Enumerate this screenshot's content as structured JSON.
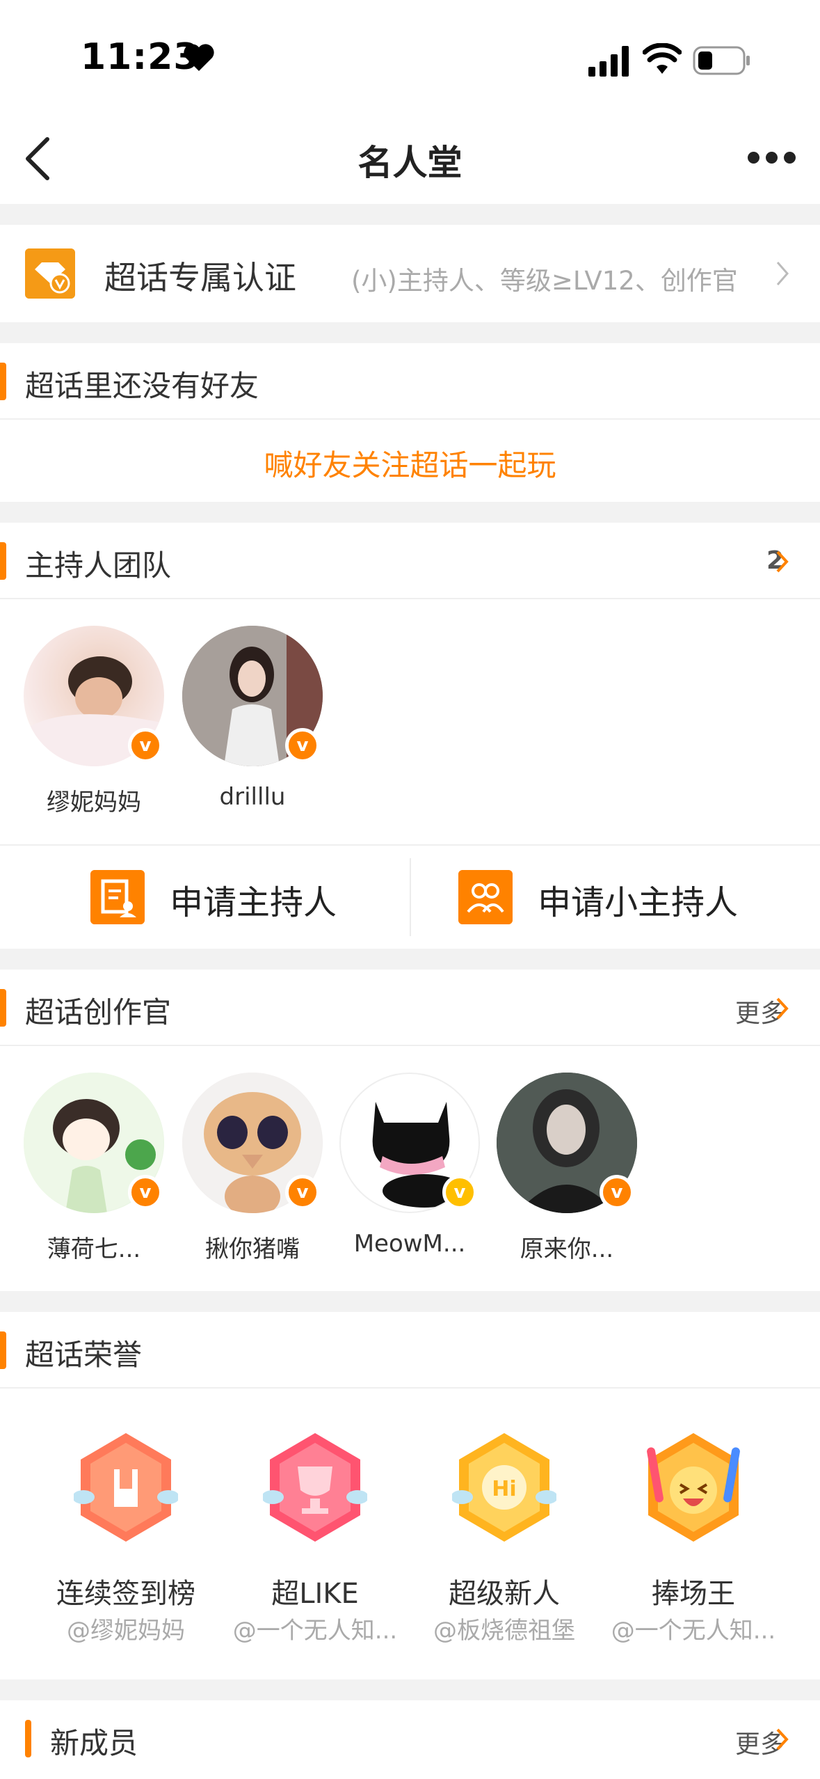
{
  "status_bar": {
    "time": "11:23"
  },
  "nav": {
    "title": "名人堂"
  },
  "cert": {
    "label": "超话专属认证",
    "requirements": "(小)主持人、等级≥LV12、创作官"
  },
  "friends": {
    "title": "超话里还没有好友",
    "invite": "喊好友关注超话一起玩"
  },
  "hosts": {
    "title": "主持人团队",
    "count": "2",
    "members": [
      {
        "name": "缪妮妈妈"
      },
      {
        "name": "drilllu"
      }
    ]
  },
  "apply": {
    "host": "申请主持人",
    "junior_host": "申请小主持人"
  },
  "creators": {
    "title": "超话创作官",
    "more": "更多",
    "members": [
      {
        "name": "薄荷七..."
      },
      {
        "name": "揪你猪嘴"
      },
      {
        "name": "MeowM..."
      },
      {
        "name": "原来你..."
      }
    ]
  },
  "honors": {
    "title": "超话荣誉",
    "items": [
      {
        "title": "连续签到榜",
        "holder": "@缪妮妈妈"
      },
      {
        "title": "超LIKE",
        "holder": "@一个无人知..."
      },
      {
        "title": "超级新人",
        "holder": "@板烧德祖堡"
      },
      {
        "title": "捧场王",
        "holder": "@一个无人知..."
      }
    ]
  },
  "new_members": {
    "title": "新成员",
    "more": "更多"
  },
  "colors": {
    "accent": "#ff8200",
    "background": "#f2f2f2"
  }
}
